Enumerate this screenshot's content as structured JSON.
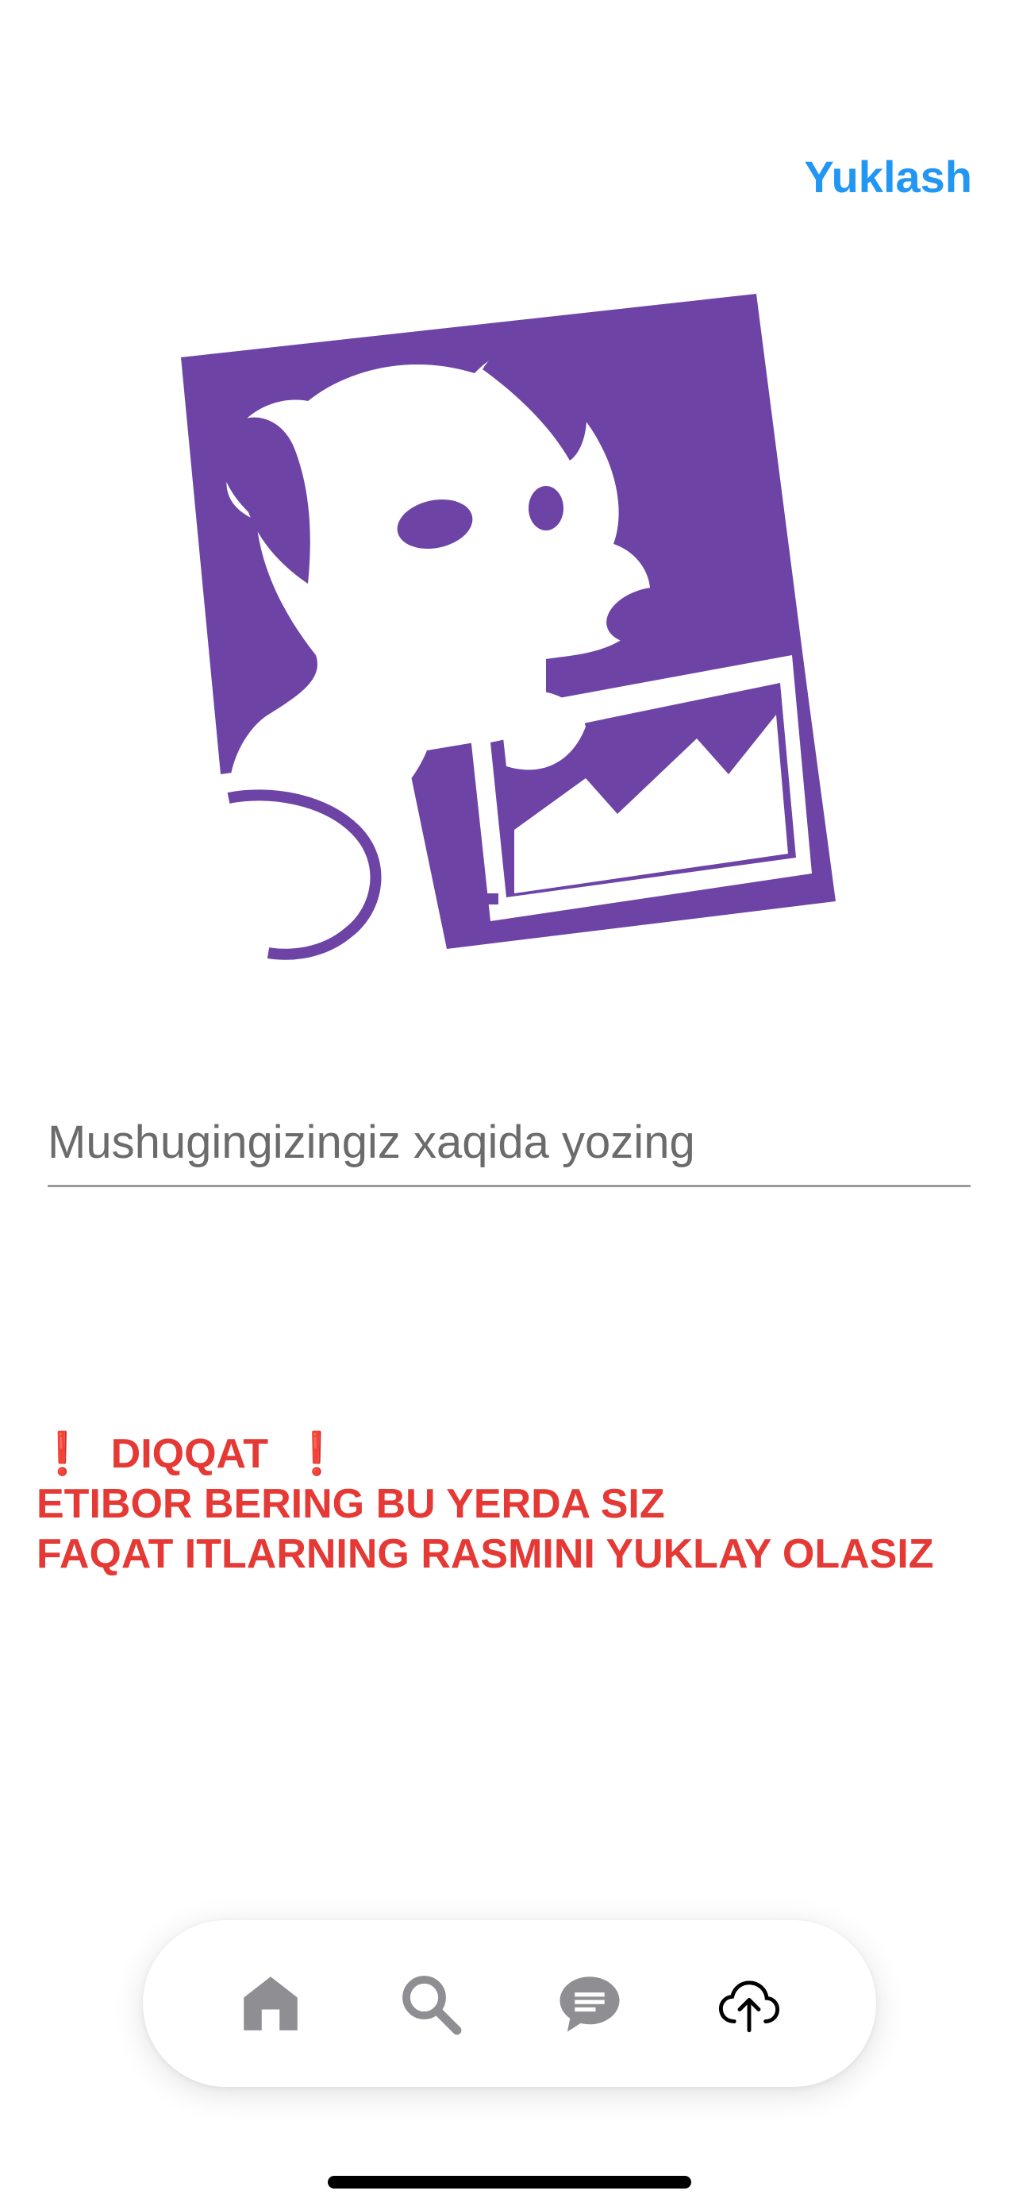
{
  "header": {
    "upload_label": "Yuklash"
  },
  "hero": {
    "logo_color": "#6d44a6",
    "logo_icon": "dog-with-chart-logo"
  },
  "form": {
    "caption_placeholder": "Mushugingizingiz xaqida yozing",
    "caption_value": ""
  },
  "warning": {
    "color": "#e53935",
    "bang": "❗",
    "title": "DIQQAT",
    "line1": "ETIBOR BERING BU YERDA SIZ",
    "line2": "FAQAT ITLARNING RASMINI YUKLAY OLASIZ"
  },
  "tabbar": {
    "items": [
      {
        "icon": "home-icon",
        "active": false
      },
      {
        "icon": "search-icon",
        "active": false
      },
      {
        "icon": "chat-icon",
        "active": false
      },
      {
        "icon": "cloud-upload-icon",
        "active": true
      }
    ],
    "inactive_color": "#8e8e93",
    "active_color": "#000000"
  }
}
